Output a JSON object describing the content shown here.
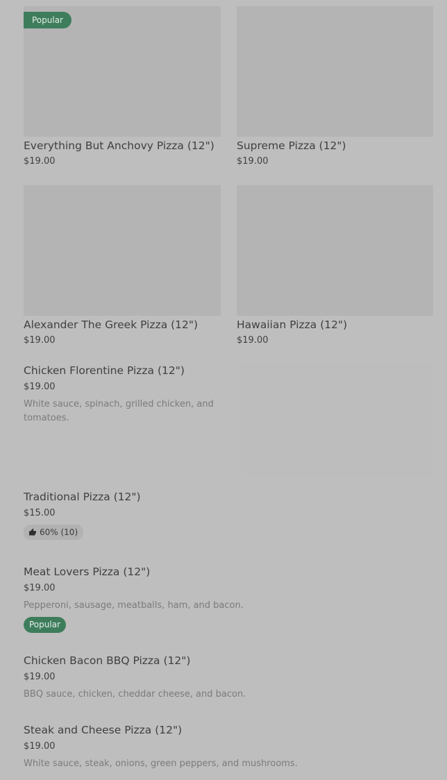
{
  "grid": [
    {
      "title": "Everything But Anchovy Pizza (12\")",
      "price": "$19.00",
      "badge": "Popular"
    },
    {
      "title": "Supreme Pizza (12\")",
      "price": "$19.00"
    },
    {
      "title": "Alexander The Greek Pizza (12\")",
      "price": "$19.00"
    },
    {
      "title": "Hawaiian Pizza (12\")",
      "price": "$19.00"
    }
  ],
  "list": [
    {
      "title": "Chicken Florentine Pizza (12\")",
      "price": "$19.00",
      "description": "White sauce, spinach, grilled chicken, and tomatoes."
    },
    {
      "title": "Traditional Pizza (12\")",
      "price": "$15.00",
      "rating": "60% (10)",
      "rating_icon": "thumbs-up-icon"
    },
    {
      "title": "Meat Lovers Pizza (12\")",
      "price": "$19.00",
      "description": "Pepperoni, sausage, meatballs, ham, and bacon.",
      "badge": "Popular"
    },
    {
      "title": "Chicken Bacon BBQ Pizza (12\")",
      "price": "$19.00",
      "description": "BBQ sauce, chicken, cheddar cheese, and bacon."
    },
    {
      "title": "Steak and Cheese Pizza (12\")",
      "price": "$19.00",
      "description": "White sauce, steak, onions, green peppers, and mushrooms."
    }
  ],
  "colors": {
    "popular_badge": "#3e7d5c",
    "overlay_background": "#bdbebd"
  }
}
